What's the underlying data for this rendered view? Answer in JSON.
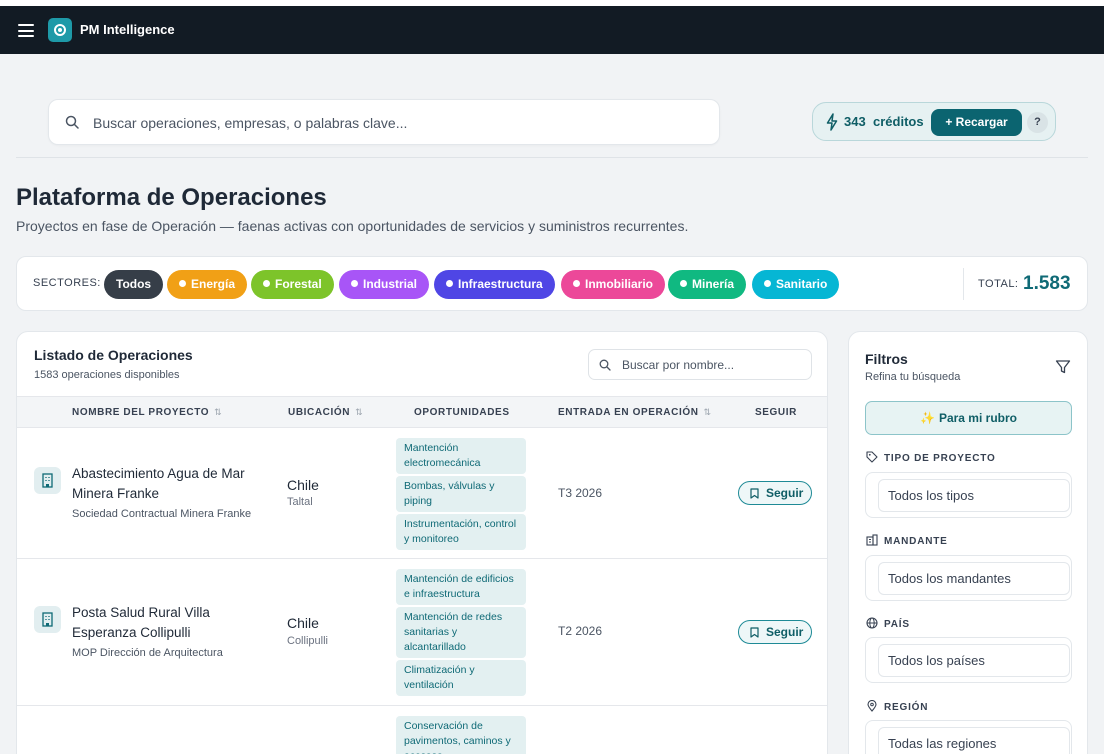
{
  "app": {
    "name": "PM Intelligence"
  },
  "search": {
    "placeholder": "Buscar operaciones, empresas, o palabras clave..."
  },
  "credits": {
    "count": "343",
    "label": "créditos",
    "recharge_label": "+ Recargar",
    "help_label": "?"
  },
  "page": {
    "title": "Plataforma de Operaciones",
    "subtitle": "Proyectos en fase de Operación — faenas activas con oportunidades de servicios y suministros recurrentes."
  },
  "sectors": {
    "label": "SECTORES:",
    "items": [
      {
        "label": "Todos",
        "color": "#363e48"
      },
      {
        "label": "Energía",
        "color": "#f1a016"
      },
      {
        "label": "Forestal",
        "color": "#7dc42a"
      },
      {
        "label": "Industrial",
        "color": "#a855f7"
      },
      {
        "label": "Infraestructura",
        "color": "#4f46e5"
      },
      {
        "label": "Inmobiliario",
        "color": "#ec4899"
      },
      {
        "label": "Minería",
        "color": "#10b981"
      },
      {
        "label": "Sanitario",
        "color": "#06b6d4"
      }
    ],
    "total_label": "TOTAL:",
    "total_value": "1.583"
  },
  "list": {
    "title": "Listado de Operaciones",
    "subtitle": "1583 operaciones disponibles",
    "search_placeholder": "Buscar por nombre...",
    "columns": [
      "NOMBRE DEL PROYECTO",
      "UBICACIÓN",
      "OPORTUNIDADES",
      "ENTRADA EN OPERACIÓN",
      "SEGUIR"
    ],
    "rows": [
      {
        "name": "Abastecimiento Agua de Mar Minera Franke",
        "owner": "Sociedad Contractual Minera Franke",
        "country": "Chile",
        "city": "Taltal",
        "opportunities": [
          "Mantención electromecánica",
          "Bombas, válvulas y piping",
          "Instrumentación, control y monitoreo"
        ],
        "entry": "T3 2026",
        "follow_label": "Seguir"
      },
      {
        "name": "Posta Salud Rural Villa Esperanza Collipulli",
        "owner": "MOP Dirección de Arquitectura",
        "country": "Chile",
        "city": "Collipulli",
        "opportunities": [
          "Mantención de edificios e infraestructura",
          "Mantención de redes sanitarias y alcantarillado",
          "Climatización y ventilación"
        ],
        "entry": "T2 2026",
        "follow_label": "Seguir"
      },
      {
        "opportunities": [
          "Conservación de pavimentos, caminos y accesos"
        ]
      }
    ]
  },
  "filters": {
    "title": "Filtros",
    "subtitle": "Refina tu búsqueda",
    "rubro_label": "Para mi rubro",
    "groups": [
      {
        "label": "TIPO DE PROYECTO",
        "value": "Todos los tipos",
        "icon": "tag-icon"
      },
      {
        "label": "MANDANTE",
        "value": "Todos los mandantes",
        "icon": "building-icon"
      },
      {
        "label": "PAÍS",
        "value": "Todos los países",
        "icon": "globe-icon"
      },
      {
        "label": "REGIÓN",
        "value": "Todas las regiones",
        "icon": "map-pin-icon"
      }
    ]
  }
}
